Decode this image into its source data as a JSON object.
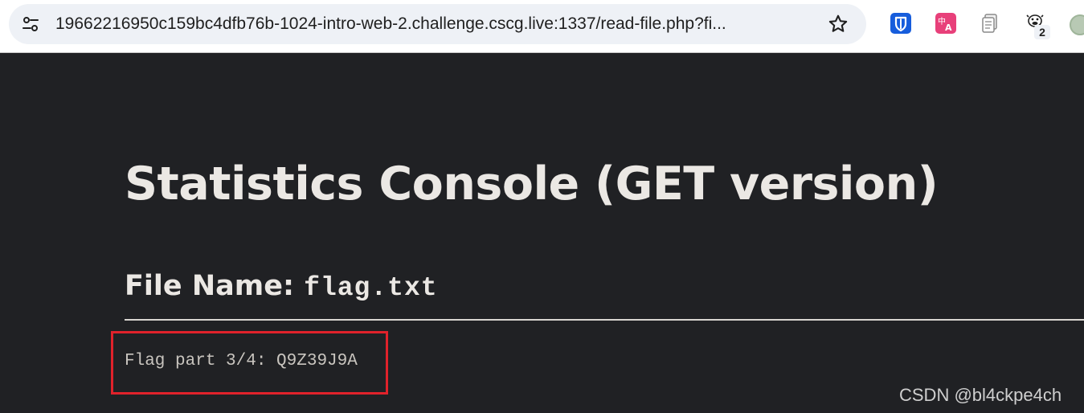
{
  "browser": {
    "url": "19662216950c159bc4dfb76b-1024-intro-web-2.challenge.cscg.live:1337/read-file.php?fi...",
    "extension_badge": "2",
    "icons": [
      "site-info-icon",
      "star-icon",
      "bitwarden-icon",
      "translate-icon",
      "copy-icon",
      "cow-icon"
    ],
    "accent_color": "#175ddc"
  },
  "page": {
    "title": "Statistics Console (GET version)",
    "file_label": "File Name:",
    "file_name": "flag.txt",
    "file_content": "Flag part 3/4: Q9Z39J9A",
    "background_color": "#202124",
    "highlight_color": "#e0222b"
  },
  "watermark": "CSDN @bl4ckpe4ch"
}
